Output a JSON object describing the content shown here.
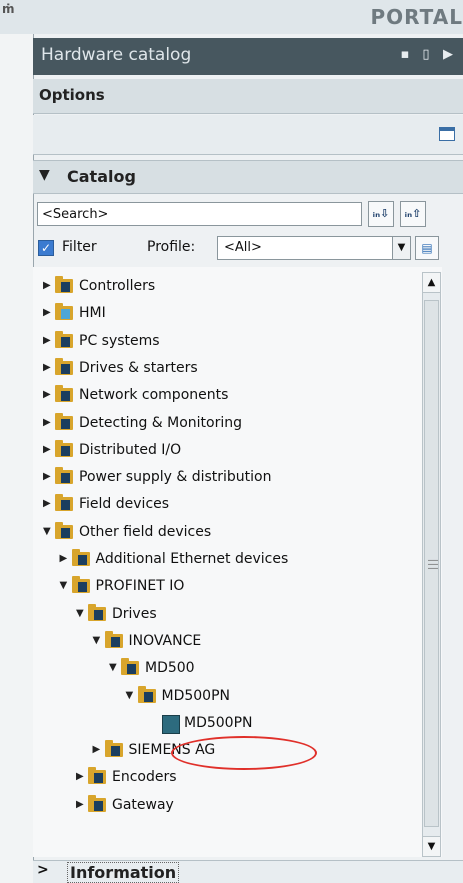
{
  "app": {
    "title": "PORTAL",
    "mark": "ṁ"
  },
  "panel": {
    "title": "Hardware catalog"
  },
  "options": {
    "title": "Options"
  },
  "catalog": {
    "title": "Catalog",
    "search_placeholder": "<Search>",
    "search_down_label": "ᵢₙ⇩",
    "search_up_label": "ᵢₙ⇧",
    "filter_label": "Filter",
    "filter_checked": true,
    "profile_label": "Profile:",
    "profile_value": "<All>"
  },
  "tree": [
    {
      "label": "Controllers",
      "expanded": false
    },
    {
      "label": "HMI",
      "expanded": false
    },
    {
      "label": "PC systems",
      "expanded": false
    },
    {
      "label": "Drives & starters",
      "expanded": false
    },
    {
      "label": "Network components",
      "expanded": false
    },
    {
      "label": "Detecting & Monitoring",
      "expanded": false
    },
    {
      "label": "Distributed I/O",
      "expanded": false
    },
    {
      "label": "Power supply & distribution",
      "expanded": false
    },
    {
      "label": "Field devices",
      "expanded": false
    },
    {
      "label": "Other field devices",
      "expanded": true
    },
    {
      "label": "Additional Ethernet devices",
      "expanded": false
    },
    {
      "label": "PROFINET IO",
      "expanded": true
    },
    {
      "label": "Drives",
      "expanded": true
    },
    {
      "label": "INOVANCE",
      "expanded": true
    },
    {
      "label": "MD500",
      "expanded": true
    },
    {
      "label": "MD500PN",
      "expanded": true
    },
    {
      "label": "MD500PN",
      "highlighted": true
    },
    {
      "label": "SIEMENS AG",
      "expanded": false
    },
    {
      "label": "Encoders",
      "expanded": false
    },
    {
      "label": "Gateway",
      "expanded": false
    }
  ],
  "information": {
    "label": "Information"
  },
  "colors": {
    "header_bg": "#47575f",
    "highlight": "#e0302a",
    "folder": "#d8a52c",
    "accent": "#3b7bd0"
  }
}
